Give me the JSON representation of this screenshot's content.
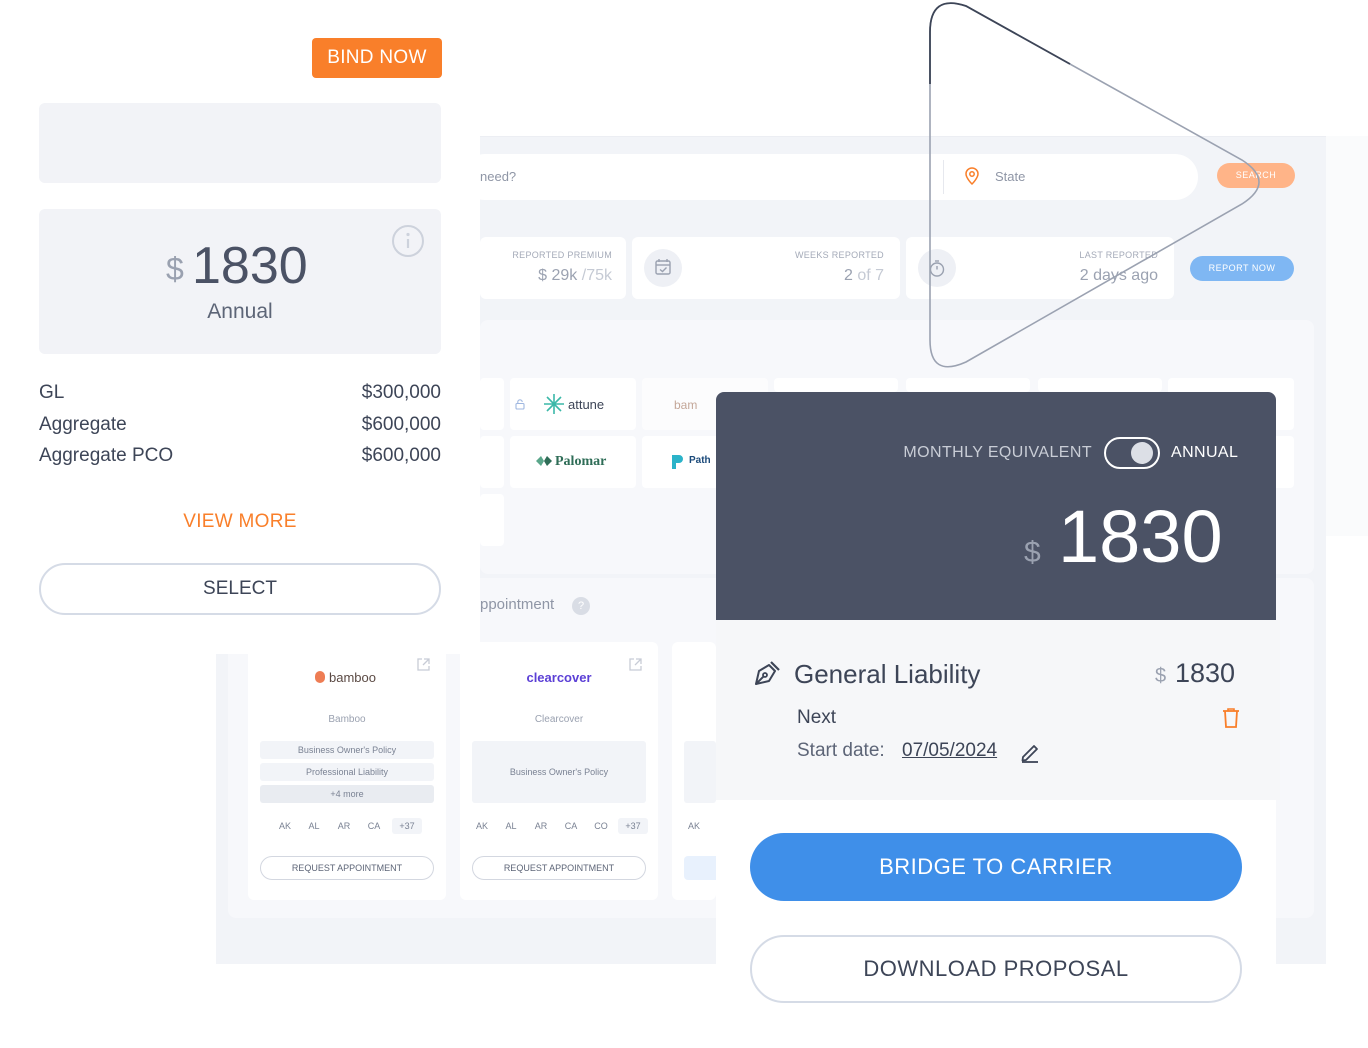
{
  "search": {
    "placeholder_tail": "need?",
    "state_placeholder": "State",
    "search_label": "SEARCH"
  },
  "stats": [
    {
      "label": "REPORTED PREMIUM",
      "value": "$ 29k",
      "suffix": "/75k"
    },
    {
      "label": "WEEKS REPORTED",
      "value": "2",
      "suffix": "of 7"
    },
    {
      "label": "LAST REPORTED",
      "value": "2 days ago",
      "suffix": ""
    }
  ],
  "report_now": "REPORT NOW",
  "carrier_logos": {
    "attune": "attune",
    "bamboo_partial": "bam",
    "palomar": "Palomar",
    "pathpoint_partial": "Path"
  },
  "appointments": {
    "heading_tail": "ppointment",
    "help": "?",
    "cards": [
      {
        "logo": "bamboo",
        "name": "Bamboo",
        "products": [
          "Business Owner's Policy",
          "Professional Liability",
          "+4 more"
        ],
        "states": [
          "AK",
          "AL",
          "AR",
          "CA",
          "+37"
        ],
        "button": "REQUEST APPOINTMENT"
      },
      {
        "logo": "clearcover",
        "name": "Clearcover",
        "products": [
          "Business Owner's Policy"
        ],
        "states": [
          "AK",
          "AL",
          "AR",
          "CA",
          "CO",
          "+37"
        ],
        "button": "REQUEST APPOINTMENT"
      },
      {
        "states": [
          "AK"
        ]
      }
    ]
  },
  "quote_card": {
    "bind_label": "BIND NOW",
    "currency": "$",
    "price": "1830",
    "period": "Annual",
    "coverages": [
      {
        "label": "GL",
        "value": "$300,000"
      },
      {
        "label": "Aggregate",
        "value": "$600,000"
      },
      {
        "label": "Aggregate PCO",
        "value": "$600,000"
      }
    ],
    "view_more": "VIEW MORE",
    "select": "SELECT"
  },
  "summary_card": {
    "monthly_label": "MONTHLY EQUIVALENT",
    "annual_label": "ANNUAL",
    "currency": "$",
    "price": "1830",
    "policy_name": "General Liability",
    "policy_currency": "$",
    "policy_price": "1830",
    "carrier": "Next",
    "start_label": "Start date:",
    "start_date": "07/05/2024",
    "bridge": "BRIDGE TO CARRIER",
    "download": "DOWNLOAD PROPOSAL"
  },
  "colors": {
    "orange": "#f97f2a",
    "blue": "#3f8fe9",
    "dark": "#4b5265"
  },
  "icons": [
    "info-icon",
    "location-pin-icon",
    "calendar-check-icon",
    "stopwatch-icon",
    "lock-icon",
    "external-link-icon",
    "pen-nib-icon",
    "trash-icon",
    "edit-pencil-icon",
    "play-icon"
  ]
}
